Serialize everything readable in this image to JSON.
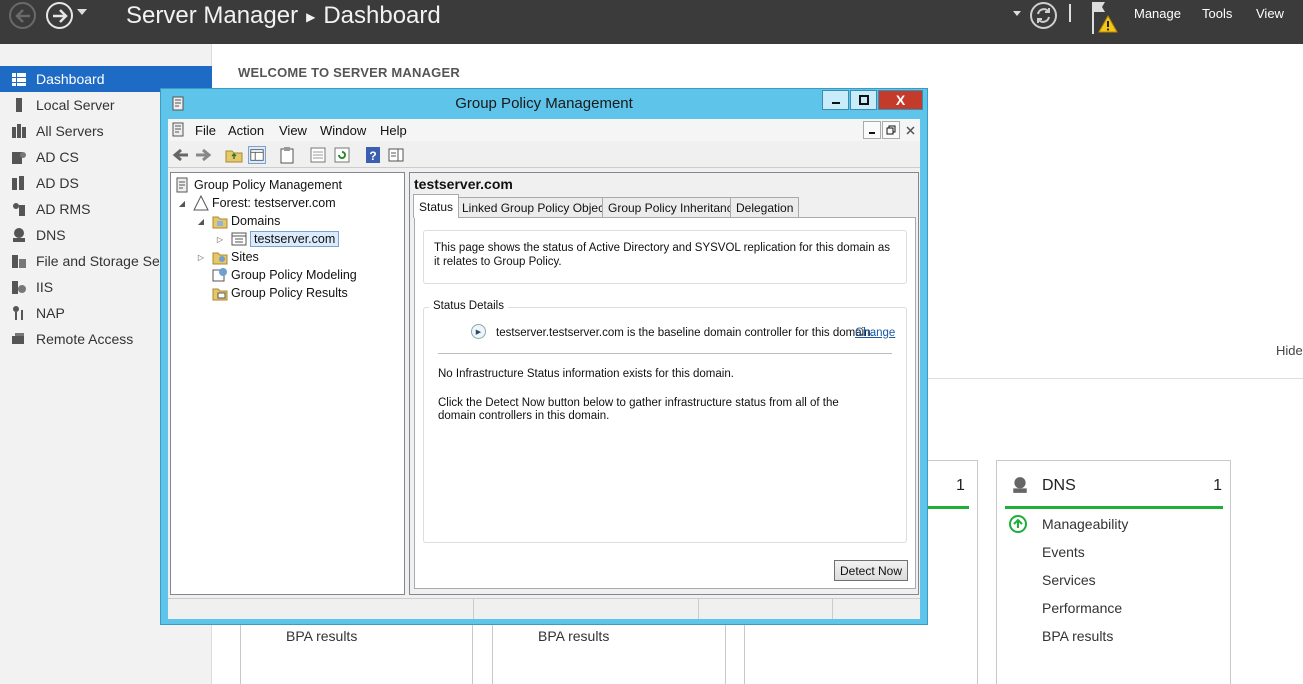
{
  "server_manager": {
    "breadcrumb_app": "Server Manager",
    "breadcrumb_page": "Dashboard",
    "menu": {
      "manage": "Manage",
      "tools": "Tools",
      "view": "View"
    },
    "sidebar": [
      {
        "label": "Dashboard",
        "icon": "dashboard-icon",
        "active": true
      },
      {
        "label": "Local Server",
        "icon": "server-icon"
      },
      {
        "label": "All Servers",
        "icon": "servers-icon"
      },
      {
        "label": "AD CS",
        "icon": "ad-cs-icon"
      },
      {
        "label": "AD DS",
        "icon": "ad-ds-icon"
      },
      {
        "label": "AD RMS",
        "icon": "ad-rms-icon"
      },
      {
        "label": "DNS",
        "icon": "dns-icon"
      },
      {
        "label": "File and Storage Ser",
        "icon": "file-storage-icon"
      },
      {
        "label": "IIS",
        "icon": "iis-icon"
      },
      {
        "label": "NAP",
        "icon": "nap-icon"
      },
      {
        "label": "Remote Access",
        "icon": "remote-access-icon"
      }
    ],
    "welcome": "WELCOME TO SERVER MANAGER",
    "hide": "Hide",
    "dns_tile": {
      "title": "DNS",
      "count": "1",
      "rows": [
        "Manageability",
        "Events",
        "Services",
        "Performance",
        "BPA results"
      ]
    },
    "partial_tile_count": "1",
    "bpa_results": "BPA results",
    "accent_green": "#1fae3a",
    "accent_blue": "#1e6bc6"
  },
  "gpmc": {
    "title": "Group Policy Management",
    "close": "X",
    "menu": [
      "File",
      "Action",
      "View",
      "Window",
      "Help"
    ],
    "tree": {
      "root": "Group Policy Management",
      "forest": "Forest: testserver.com",
      "domains": "Domains",
      "domain": "testserver.com",
      "sites": "Sites",
      "modeling": "Group Policy Modeling",
      "results": "Group Policy Results"
    },
    "pane_title": "testserver.com",
    "tabs": [
      "Status",
      "Linked Group Policy Objects",
      "Group Policy Inheritance",
      "Delegation"
    ],
    "info_text": "This page shows the status of Active Directory and SYSVOL replication for this domain as it relates to Group Policy.",
    "status_details": "Status Details",
    "baseline_text": "testserver.testserver.com is the baseline domain controller for this domain.",
    "change": "Change",
    "no_infra": "No Infrastructure Status information exists for this domain.",
    "click_detect": "Click the Detect Now button below to gather infrastructure status from all of the domain controllers in this domain.",
    "detect_now": "Detect Now",
    "title_color": "#5ec4ea"
  }
}
